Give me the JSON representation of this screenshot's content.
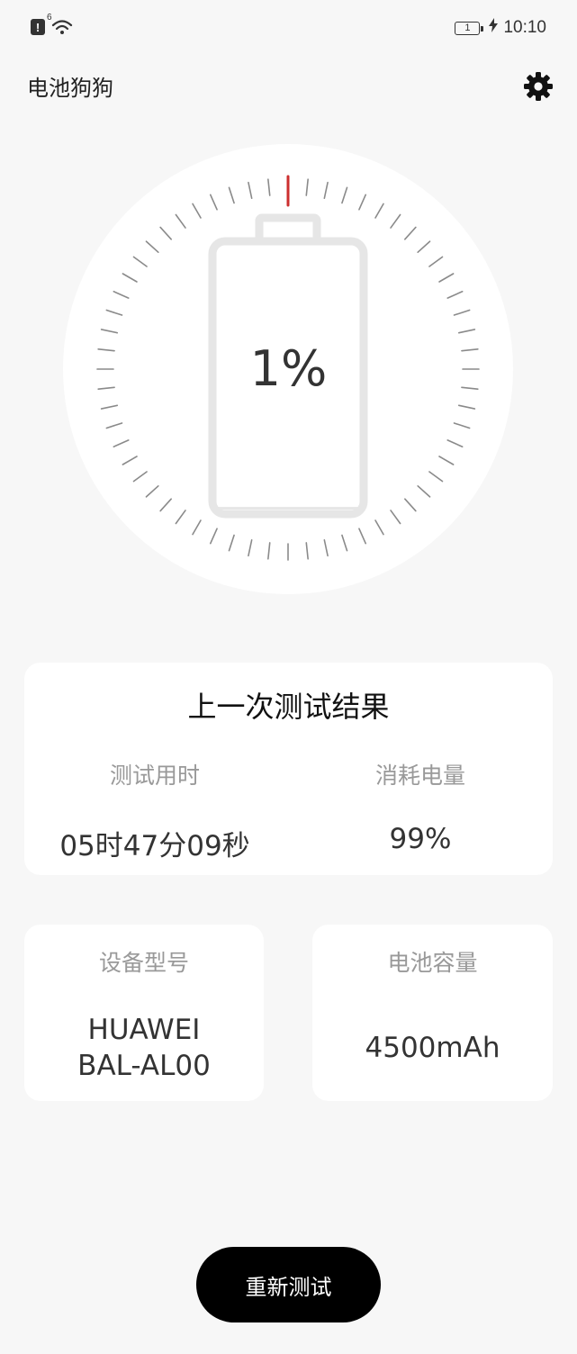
{
  "status_bar": {
    "alert_glyph": "!",
    "signal_label": "6",
    "battery_level": "1",
    "time": "10:10"
  },
  "header": {
    "title": "电池狗狗",
    "settings_icon": "gear-icon"
  },
  "gauge": {
    "percent_text": "1%",
    "level_fraction": 0.01,
    "accent_color": "#cc2f2f"
  },
  "last_result": {
    "title": "上一次测试结果",
    "duration_label": "测试用时",
    "duration_value": "05时47分09秒",
    "consumed_label": "消耗电量",
    "consumed_value": "99%"
  },
  "device": {
    "label": "设备型号",
    "value_line1": "HUAWEI",
    "value_line2": "BAL-AL00"
  },
  "capacity": {
    "label": "电池容量",
    "value": "4500mAh"
  },
  "retest_button": {
    "label": "重新测试"
  }
}
